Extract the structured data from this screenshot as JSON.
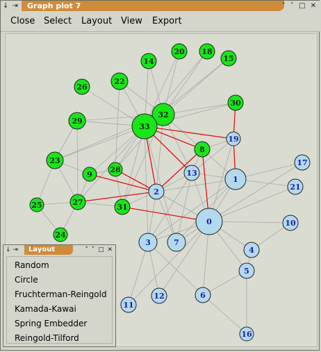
{
  "window": {
    "title": "Graph plot 7",
    "left_controls": "↓ ⇥",
    "right_controls": "˄ ˅ □ ✕"
  },
  "menu": [
    "Close",
    "Select",
    "Layout",
    "View",
    "Export"
  ],
  "colors": {
    "green_node": "#19e619",
    "blue_node": "#b3d9ee",
    "node_label": "#1a1aa8",
    "edge": "#a8a8a8",
    "highlight_edge": "#e01010",
    "title_tab": "#cf8c3b"
  },
  "graph": {
    "nodes": [
      {
        "id": "0",
        "type": "blue"
      },
      {
        "id": "1",
        "type": "blue"
      },
      {
        "id": "2",
        "type": "blue"
      },
      {
        "id": "3",
        "type": "blue"
      },
      {
        "id": "4",
        "type": "blue"
      },
      {
        "id": "5",
        "type": "blue"
      },
      {
        "id": "6",
        "type": "blue"
      },
      {
        "id": "7",
        "type": "blue"
      },
      {
        "id": "8",
        "type": "green"
      },
      {
        "id": "9",
        "type": "green"
      },
      {
        "id": "10",
        "type": "blue"
      },
      {
        "id": "11",
        "type": "blue"
      },
      {
        "id": "12",
        "type": "blue"
      },
      {
        "id": "13",
        "type": "blue"
      },
      {
        "id": "14",
        "type": "green"
      },
      {
        "id": "15",
        "type": "green"
      },
      {
        "id": "16",
        "type": "blue"
      },
      {
        "id": "17",
        "type": "blue"
      },
      {
        "id": "18",
        "type": "green"
      },
      {
        "id": "19",
        "type": "blue"
      },
      {
        "id": "20",
        "type": "green"
      },
      {
        "id": "21",
        "type": "blue"
      },
      {
        "id": "22",
        "type": "green"
      },
      {
        "id": "23",
        "type": "green"
      },
      {
        "id": "24",
        "type": "green"
      },
      {
        "id": "25",
        "type": "green"
      },
      {
        "id": "26",
        "type": "green"
      },
      {
        "id": "27",
        "type": "green"
      },
      {
        "id": "28",
        "type": "green"
      },
      {
        "id": "29",
        "type": "green"
      },
      {
        "id": "30",
        "type": "green"
      },
      {
        "id": "31",
        "type": "green"
      },
      {
        "id": "32",
        "type": "green"
      },
      {
        "id": "33",
        "type": "green"
      }
    ],
    "highlighted_edges": [
      [
        "33",
        "8"
      ],
      [
        "33",
        "19"
      ],
      [
        "33",
        "2"
      ],
      [
        "33",
        "13"
      ],
      [
        "8",
        "2"
      ],
      [
        "8",
        "0"
      ],
      [
        "19",
        "30"
      ],
      [
        "19",
        "1"
      ],
      [
        "2",
        "9"
      ],
      [
        "2",
        "27"
      ],
      [
        "2",
        "28"
      ],
      [
        "31",
        "0"
      ]
    ]
  },
  "layout_window": {
    "title": "Layout",
    "left_controls": "↓ ⇥",
    "right_controls": "˄ ˅ □ ✕",
    "options": [
      "Random",
      "Circle",
      "Fruchterman-Reingold",
      "Kamada-Kawai",
      "Spring Embedder",
      "Reingold-Tilford"
    ]
  }
}
